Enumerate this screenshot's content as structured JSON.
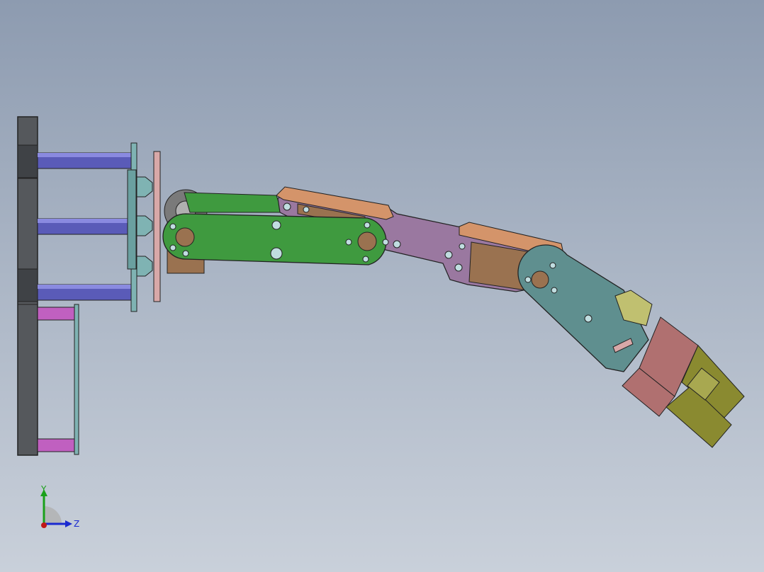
{
  "viewport": {
    "background_top": "#8d9bb0",
    "background_bottom": "#c9d0da"
  },
  "triad": {
    "y_label": "Y",
    "z_label": "Z",
    "y_color": "#1aa01a",
    "z_color": "#1a2ad0",
    "x_color": "#c01818"
  },
  "part_colors": {
    "frame": "#55585c",
    "standoff_blue": "#5a5bb8",
    "standoff_pink": "#c060c0",
    "plate_teal": "#7fb3b3",
    "plate_pink": "#d8a8a8",
    "link_green": "#3f9a3f",
    "link_purple": "#9a78a0",
    "servo_bracket": "#d4946a",
    "servo_body": "#9a7250",
    "wrist_teal": "#5f8f8f",
    "gripper_base": "#b07070",
    "gripper_finger": "#8a8a30"
  }
}
